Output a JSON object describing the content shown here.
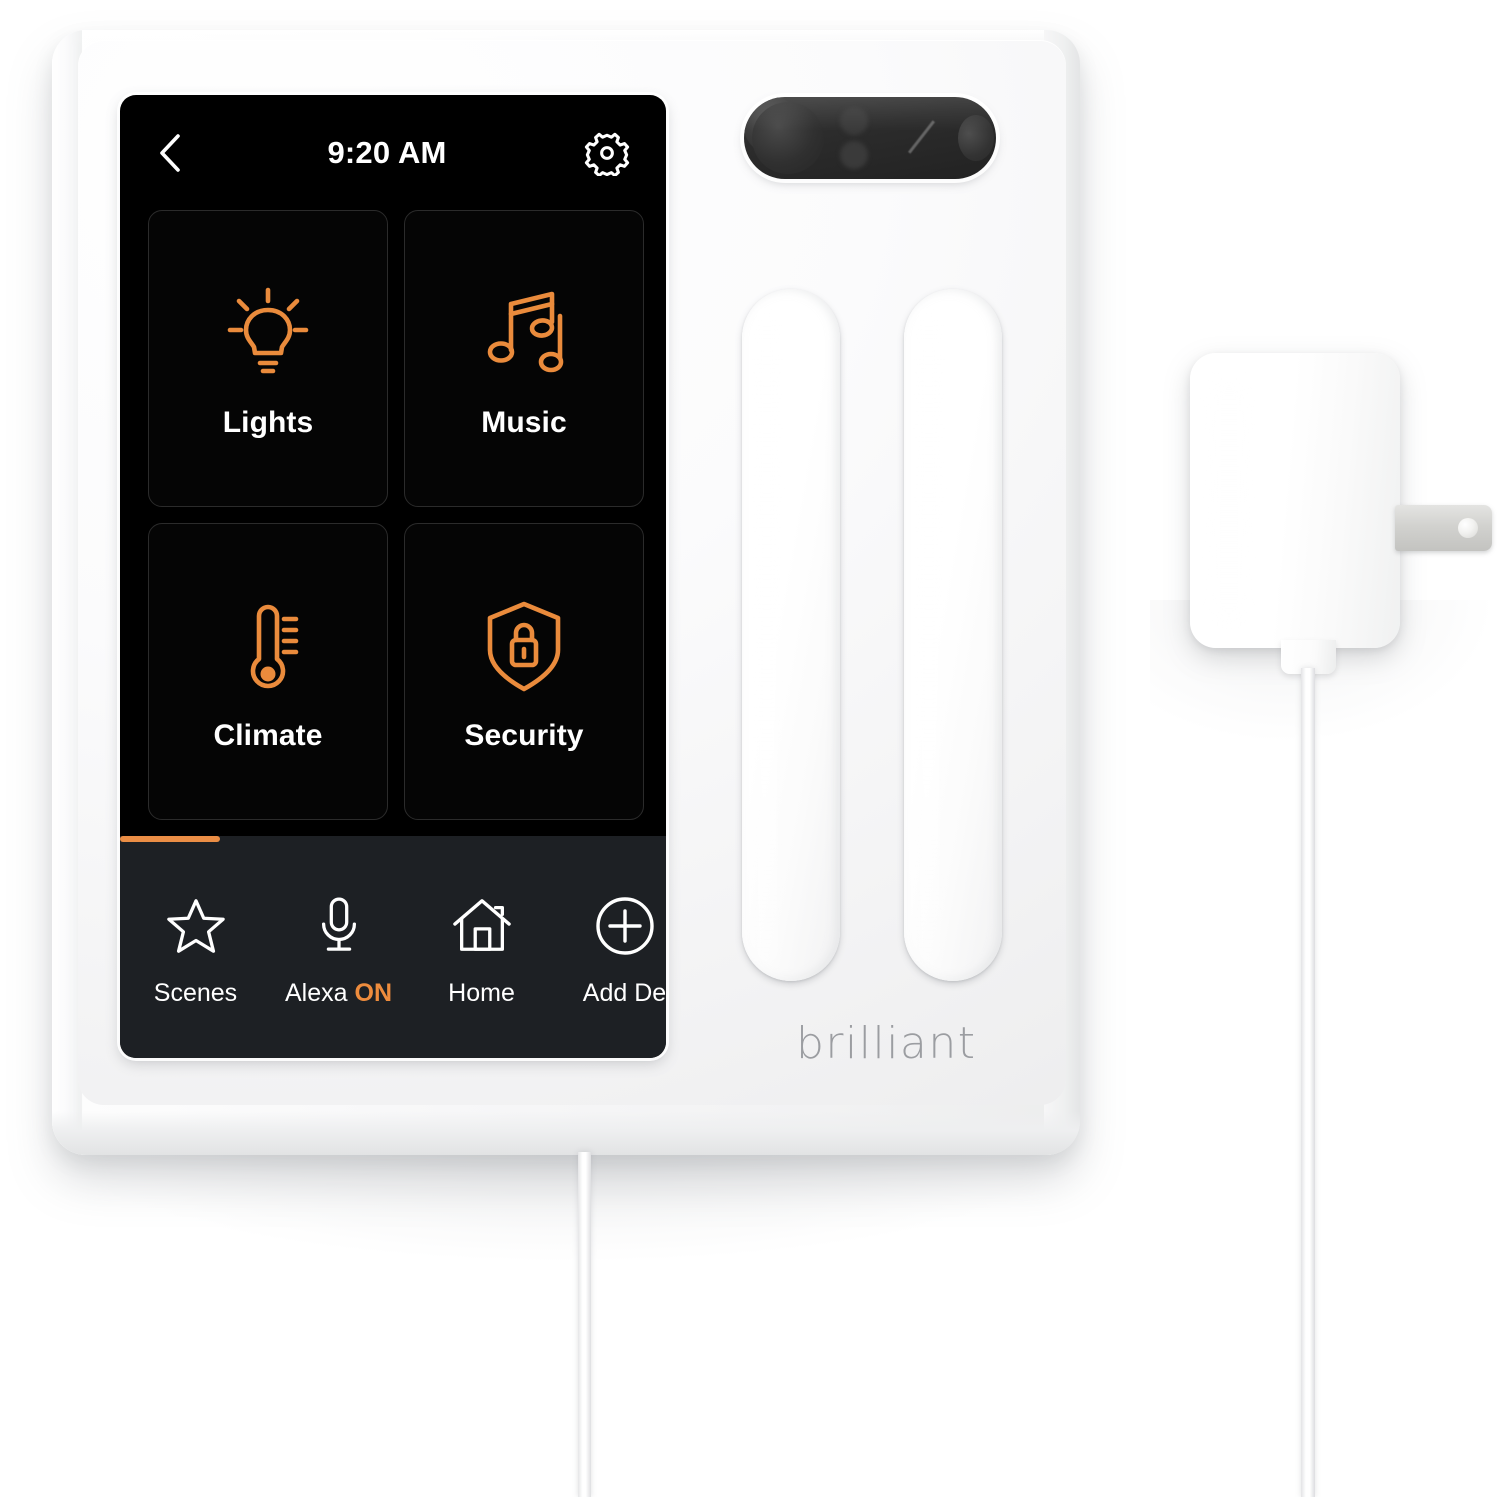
{
  "product": {
    "brand": "brilliant",
    "brand_color": "#9b9da1"
  },
  "theme": {
    "accent": "#ea8b3c",
    "screen_bg": "#000000",
    "navbar_bg": "#1d2024",
    "text": "#ffffff",
    "tile_border": "#2b2b2b",
    "faceplate": "#f4f4f5"
  },
  "screen": {
    "header": {
      "back_icon": "chevron-left-icon",
      "time": "9:20 AM",
      "settings_icon": "gear-icon"
    },
    "tiles": [
      {
        "label": "Lights",
        "icon": "lightbulb-icon"
      },
      {
        "label": "Music",
        "icon": "music-note-icon"
      },
      {
        "label": "Climate",
        "icon": "thermometer-icon"
      },
      {
        "label": "Security",
        "icon": "shield-lock-icon"
      }
    ],
    "nav": {
      "progress_label": "",
      "items": [
        {
          "label": "Scenes",
          "icon": "star-icon",
          "status": ""
        },
        {
          "label": "Alexa",
          "icon": "microphone-icon",
          "status": "ON"
        },
        {
          "label": "Home",
          "icon": "house-icon",
          "status": ""
        },
        {
          "label": "Add De",
          "icon": "plus-circle-icon",
          "status": ""
        }
      ]
    }
  },
  "hardware": {
    "sensor_bar": "sensor-camera-bar",
    "sliders": [
      {
        "name": "slider-left"
      },
      {
        "name": "slider-right"
      }
    ],
    "power_adapter": "usb-power-adapter",
    "cable": "power-cable"
  }
}
